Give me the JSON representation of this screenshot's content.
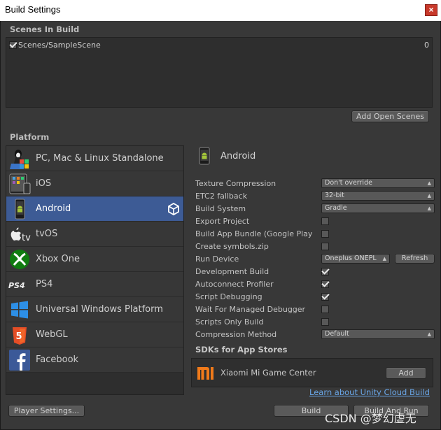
{
  "window": {
    "title": "Build Settings",
    "close_glyph": "×"
  },
  "scenes": {
    "section_label": "Scenes In Build",
    "items": [
      {
        "name": "Scenes/SampleScene",
        "index": "0",
        "checked": true
      }
    ],
    "add_open_scenes_label": "Add Open Scenes"
  },
  "platform": {
    "section_label": "Platform",
    "items": [
      {
        "label": "PC, Mac & Linux Standalone",
        "icon": "pc-mac-linux-icon",
        "selected": false
      },
      {
        "label": "iOS",
        "icon": "ios-icon",
        "selected": false
      },
      {
        "label": "Android",
        "icon": "android-icon",
        "selected": true
      },
      {
        "label": "tvOS",
        "icon": "tvos-icon",
        "selected": false
      },
      {
        "label": "Xbox One",
        "icon": "xbox-one-icon",
        "selected": false
      },
      {
        "label": "PS4",
        "icon": "ps4-icon",
        "selected": false
      },
      {
        "label": "Universal Windows Platform",
        "icon": "windows-icon",
        "selected": false
      },
      {
        "label": "WebGL",
        "icon": "html5-icon",
        "selected": false
      },
      {
        "label": "Facebook",
        "icon": "facebook-icon",
        "selected": false
      }
    ]
  },
  "android": {
    "title": "Android",
    "texture_compression": {
      "label": "Texture Compression",
      "value": "Don't override"
    },
    "etc2_fallback": {
      "label": "ETC2 fallback",
      "value": "32-bit"
    },
    "build_system": {
      "label": "Build System",
      "value": "Gradle"
    },
    "export_project": {
      "label": "Export Project",
      "checked": false
    },
    "build_app_bundle": {
      "label": "Build App Bundle (Google Play)",
      "checked": false
    },
    "create_symbols": {
      "label": "Create symbols.zip",
      "checked": false
    },
    "run_device": {
      "label": "Run Device",
      "value": "Oneplus ONEPL",
      "refresh_label": "Refresh"
    },
    "development_build": {
      "label": "Development Build",
      "checked": true
    },
    "autoconnect_profiler": {
      "label": "Autoconnect Profiler",
      "checked": true
    },
    "script_debugging": {
      "label": "Script Debugging",
      "checked": true
    },
    "wait_managed_debugger": {
      "label": "Wait For Managed Debugger",
      "checked": false
    },
    "scripts_only_build": {
      "label": "Scripts Only Build",
      "checked": false
    },
    "compression_method": {
      "label": "Compression Method",
      "value": "Default"
    },
    "sdk_title": "SDKs for App Stores",
    "sdk_item": {
      "name": "Xiaomi Mi Game Center",
      "add_label": "Add"
    },
    "cloud_link": "Learn about Unity Cloud Build"
  },
  "footer": {
    "player_settings_label": "Player Settings...",
    "build_label": "Build",
    "build_and_run_label": "Build And Run"
  },
  "watermark": "CSDN @梦幻虚无",
  "colors": {
    "background": "#383838",
    "selected": "#3d5b95",
    "link": "#6aa7e8",
    "close": "#c8392b"
  }
}
